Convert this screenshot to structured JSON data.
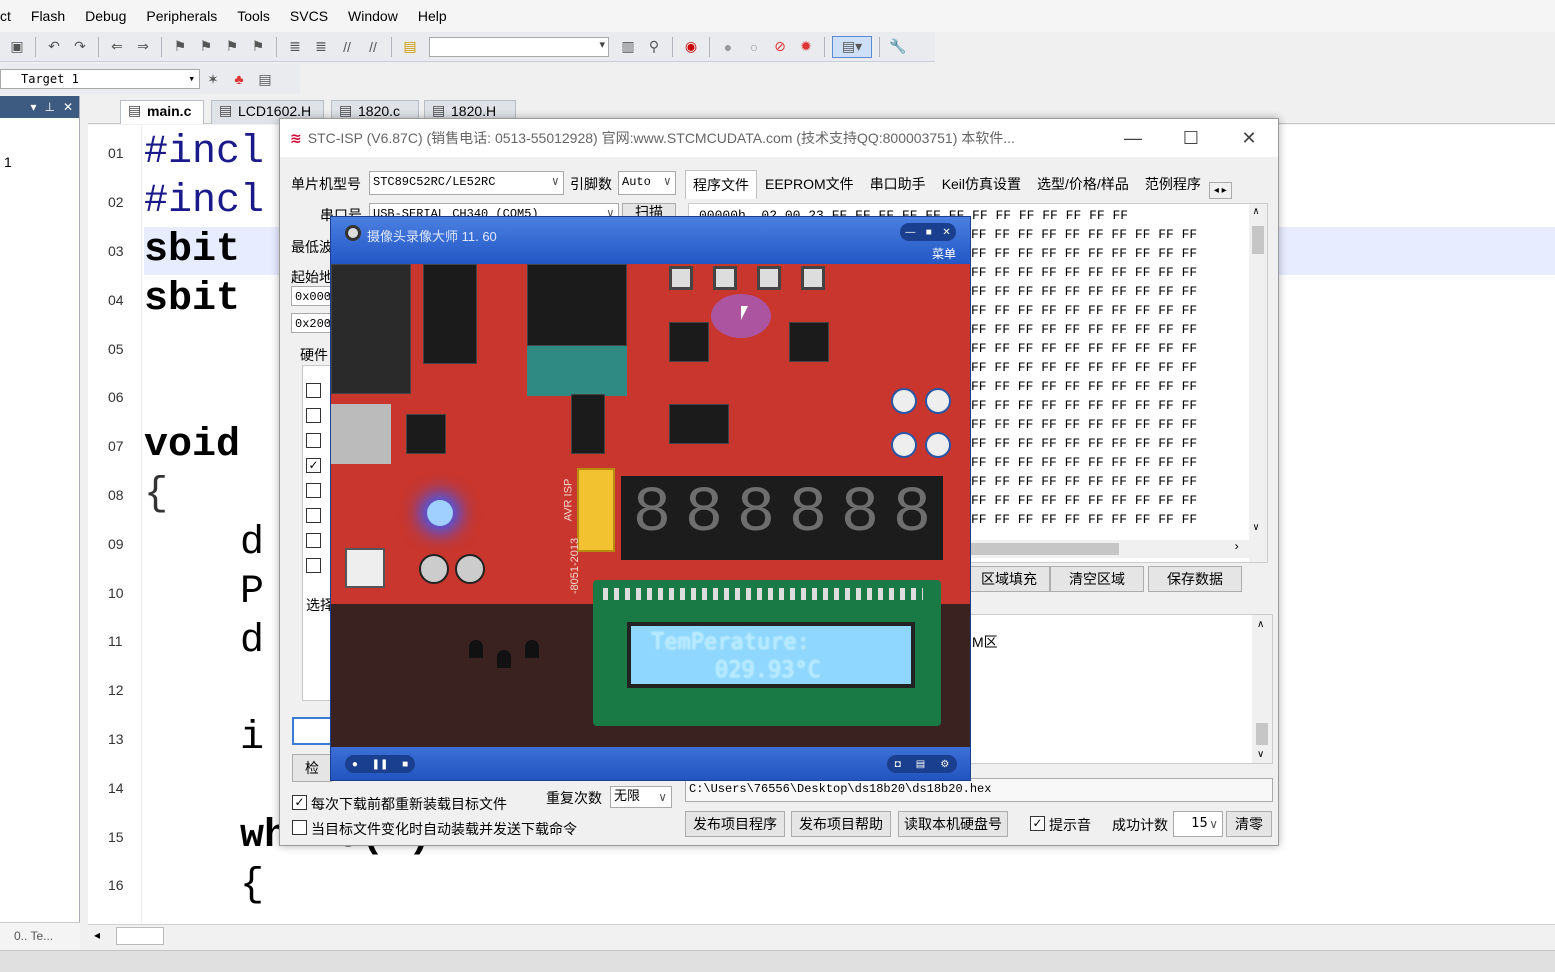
{
  "menubar": [
    "ct",
    "Flash",
    "Debug",
    "Peripherals",
    "Tools",
    "SVCS",
    "Window",
    "Help"
  ],
  "target": "Target 1",
  "project_node": "1",
  "bottom_tab": "0.. Te...",
  "file_tabs": [
    "main.c",
    "LCD1602.H",
    "1820.c",
    "1820.H"
  ],
  "editor": {
    "line_numbers": [
      "01",
      "02",
      "03",
      "04",
      "05",
      "06",
      "07",
      "08",
      "09",
      "10",
      "11",
      "12",
      "13",
      "14",
      "15",
      "16"
    ],
    "lines": [
      "#incl",
      "#incl",
      "sbit",
      "sbit",
      "",
      "",
      "void",
      "{",
      "    d",
      "    P",
      "    d",
      "",
      "    i",
      "",
      "    while(1)",
      "    {"
    ]
  },
  "stc": {
    "title": "STC-ISP (V6.87C) (销售电话: 0513-55012928) 官网:www.STCMCUDATA.com  (技术支持QQ:800003751) 本软件...",
    "mcu_label": "单片机型号",
    "mcu_value": "STC89C52RC/LE52RC",
    "pin_label": "引脚数",
    "pin_value": "Auto",
    "port_label": "串口号",
    "port_value": "USB-SERIAL CH340 (COM5)",
    "scan_button": "扫描",
    "min_baud_label": "最低波",
    "start_addr_label": "起始地",
    "addr1": "0x000",
    "addr2": "0x200",
    "hw_tab": "硬件",
    "select_label": "选择",
    "check_button": "检",
    "tabs": [
      "程序文件",
      "EEPROM文件",
      "串口助手",
      "Keil仿真设置",
      "选型/价格/样品",
      "范例程序"
    ],
    "hex_first_row": "00000h  02 00 23 FF FF FF FF FF FF FF FF FF FF FF FF FF",
    "hex_row": "FF FF FF FF FF FF FF FF FF FF",
    "btn_fill": "区域填充",
    "btn_clear": "清空区域",
    "btn_save": "保存数据",
    "log_text": "M区",
    "reload_label": "每次下载前都重新装载目标文件",
    "auto_label": "当目标文件变化时自动装载并发送下载命令",
    "repeat_label": "重复次数",
    "repeat_value": "无限",
    "path": "C:\\Users\\76556\\Desktop\\ds18b20\\ds18b20.hex",
    "btn_publish": "发布项目程序",
    "btn_help": "发布项目帮助",
    "btn_read_id": "读取本机硬盘号",
    "sound_label": "提示音",
    "count_label": "成功计数",
    "count_value": "15",
    "btn_reset": "清零"
  },
  "camera": {
    "title": "摄像头录像大师  11. 60",
    "menu": "菜单",
    "lcd_line1": "TemPerature:",
    "lcd_line2": "029.93°C",
    "board_text_avr": "AVR ISP",
    "board_text_model": "-8051-2013",
    "seven_seg": [
      "8",
      "8",
      "8",
      "8",
      "8",
      "8"
    ]
  },
  "colors": {
    "camera_blue": "#2a5bc4",
    "pcb_red": "#c8362d",
    "lcd_blue": "#8fd7ff",
    "editor_highlight": "#e8ecff"
  }
}
